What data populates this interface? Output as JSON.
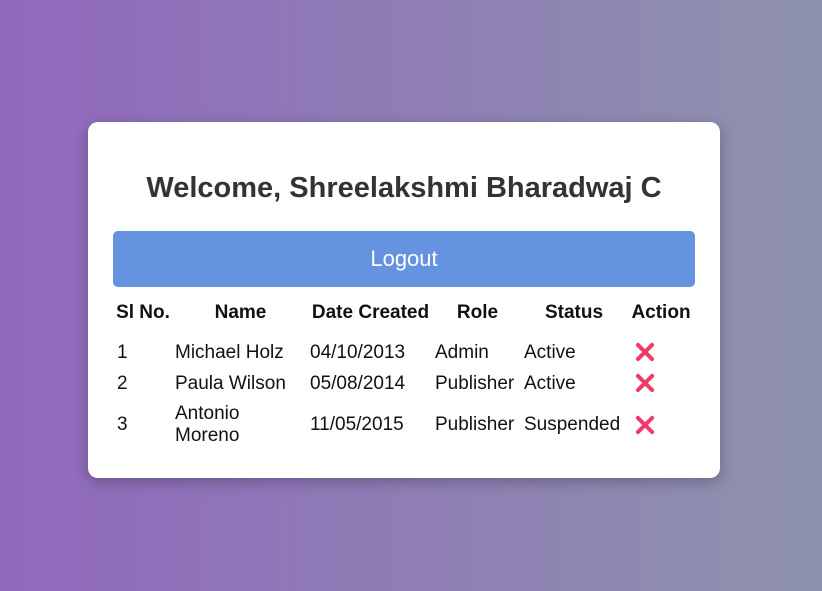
{
  "welcome": {
    "text": "Welcome, Shreelakshmi Bharadwaj C"
  },
  "logout": {
    "label": "Logout",
    "color": "#6693e0"
  },
  "table": {
    "headers": [
      "Sl No.",
      "Name",
      "Date Created",
      "Role",
      "Status",
      "Action"
    ],
    "rows": [
      {
        "sl": "1",
        "name": "Michael Holz",
        "date": "04/10/2013",
        "role": "Admin",
        "status": "Active",
        "action_icon": "close-icon"
      },
      {
        "sl": "2",
        "name": "Paula Wilson",
        "date": "05/08/2014",
        "role": "Publisher",
        "status": "Active",
        "action_icon": "close-icon"
      },
      {
        "sl": "3",
        "name": "Antonio Moreno",
        "date": "11/05/2015",
        "role": "Publisher",
        "status": "Suspended",
        "action_icon": "close-icon"
      }
    ]
  },
  "colors": {
    "delete_icon": "#ef3a6a",
    "background_start": "#9068bd",
    "background_end": "#8e93ad"
  }
}
